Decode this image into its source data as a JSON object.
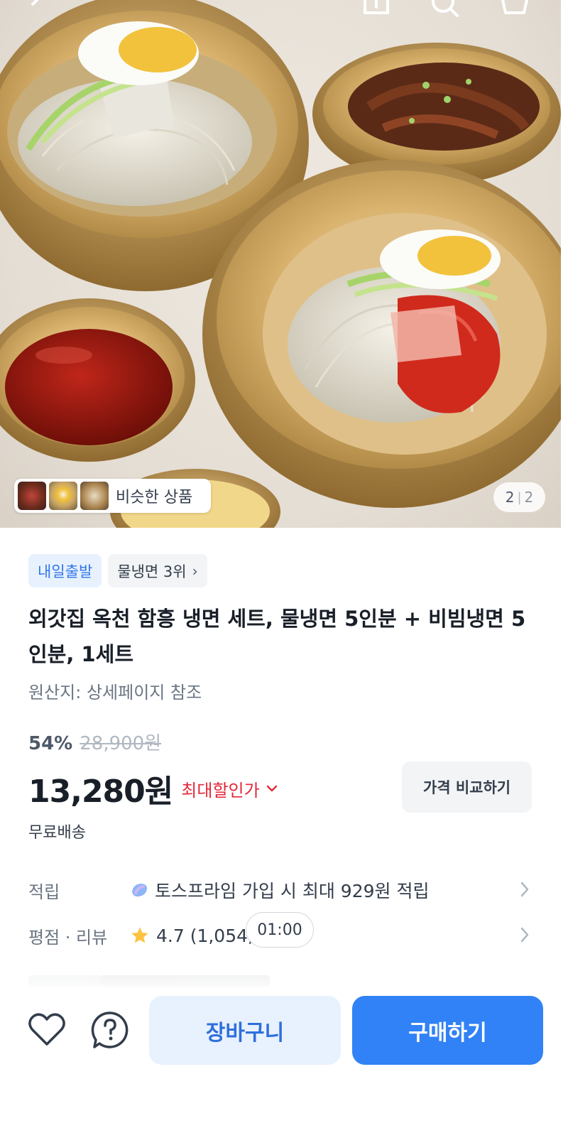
{
  "gallery": {
    "similar_label": "비슷한 상품",
    "page_current": "2",
    "page_total": "2"
  },
  "tags": {
    "delivery": "내일출발",
    "rank": "물냉면 3위"
  },
  "product": {
    "title": "외갓집 옥천 함흥 냉면 세트, 물냉면 5인분 + 비빔냉면 5인분, 1세트",
    "origin": "원산지: 상세페이지 참조",
    "discount": "54%",
    "original_price": "28,900원",
    "price": "13,280원",
    "max_discount_label": "최대할인가",
    "compare_button": "가격 비교하기",
    "shipping": "무료배송"
  },
  "details": {
    "points_label": "적립",
    "points_value": "토스프라임 가입 시 최대 929원 적립",
    "rating_label": "평점 · 리뷰",
    "rating_value": "4.7 (1,054,",
    "timer": "01:00"
  },
  "actions": {
    "cart": "장바구니",
    "buy": "구매하기"
  },
  "colors": {
    "primary": "#3182f6",
    "sale_red": "#e42939",
    "tag_blue": "#2f76e8"
  }
}
